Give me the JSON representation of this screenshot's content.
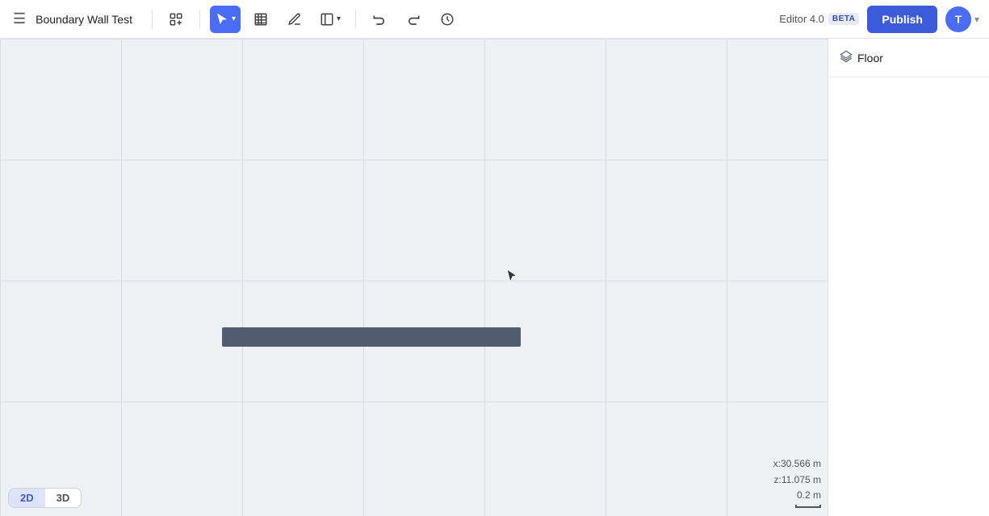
{
  "header": {
    "project_title": "Boundary Wall Test",
    "editor_label": "Editor 4.0",
    "beta_label": "BETA",
    "publish_label": "Publish",
    "user_initial": "T"
  },
  "toolbar": {
    "menu_icon": "☰",
    "tools": [
      {
        "id": "add",
        "label": "Add tool",
        "icon": "add"
      },
      {
        "id": "select",
        "label": "Select",
        "icon": "select",
        "active": true,
        "has_dropdown": true
      },
      {
        "id": "texture",
        "label": "Texture",
        "icon": "texture"
      },
      {
        "id": "pen",
        "label": "Pen",
        "icon": "pen"
      },
      {
        "id": "view",
        "label": "View",
        "icon": "view",
        "has_dropdown": true
      },
      {
        "id": "undo",
        "label": "Undo",
        "icon": "undo"
      },
      {
        "id": "redo",
        "label": "Redo",
        "icon": "redo"
      },
      {
        "id": "history",
        "label": "History",
        "icon": "history"
      }
    ]
  },
  "canvas": {
    "wall": {
      "color": "#525c6e"
    },
    "coords": {
      "x": "x:30.566 m",
      "z": "z:11.075 m",
      "scale": "0.2 m"
    }
  },
  "view_modes": [
    {
      "id": "2d",
      "label": "2D",
      "active": true
    },
    {
      "id": "3d",
      "label": "3D",
      "active": false
    }
  ],
  "right_panel": {
    "title": "Floor",
    "icon": "layers"
  }
}
